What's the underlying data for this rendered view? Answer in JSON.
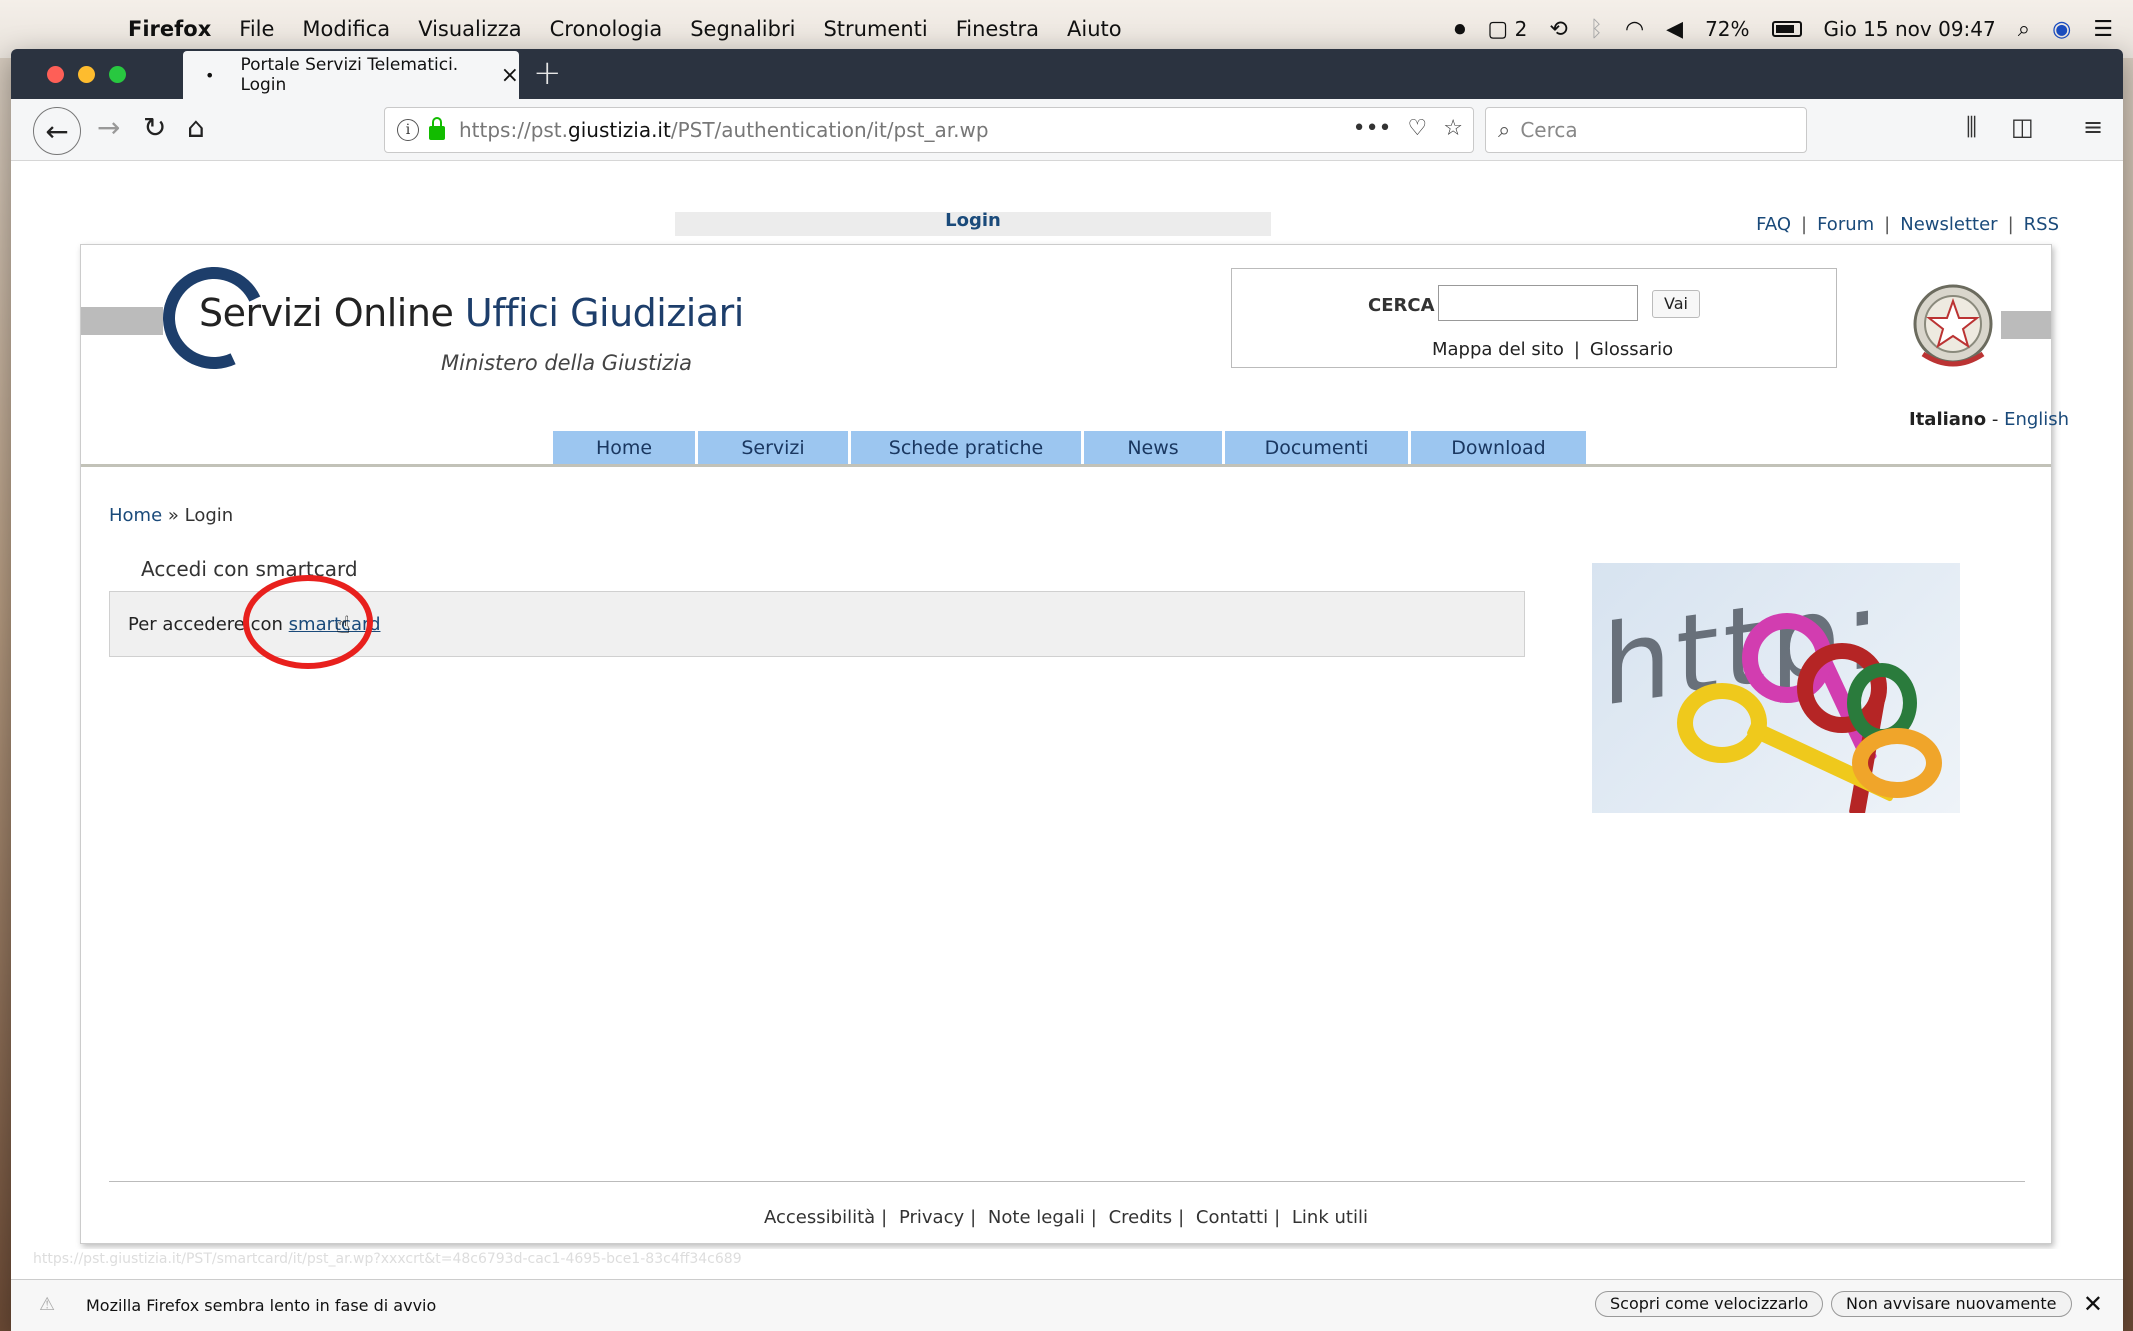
{
  "menubar": {
    "app": "Firefox",
    "items": [
      "File",
      "Modifica",
      "Visualizza",
      "Cronologia",
      "Segnalibri",
      "Strumenti",
      "Finestra",
      "Aiuto"
    ],
    "desktop_count": "2",
    "battery": "72%",
    "datetime": "Gio 15 nov  09:47"
  },
  "browser": {
    "tab_title": "Portale Servizi Telematici. Login",
    "url_prefix": "https://pst.",
    "url_host": "giustizia.it",
    "url_path": "/PST/authentication/it/pst_ar.wp",
    "search_placeholder": "Cerca"
  },
  "page": {
    "top_title": "Login",
    "top_links": [
      "FAQ",
      "Forum",
      "Newsletter",
      "RSS"
    ],
    "logo_part1": "Servizi Online ",
    "logo_part2": "Uffici Giudiziari",
    "logo_sub": "Ministero della Giustizia",
    "search_label": "CERCA",
    "search_button": "Vai",
    "sitemap": "Mappa del sito",
    "glossary": "Glossario",
    "lang_it": "Italiano",
    "lang_en": "English",
    "nav": [
      "Home",
      "Servizi",
      "Schede pratiche",
      "News",
      "Documenti",
      "Download"
    ],
    "breadcrumb_home": "Home",
    "breadcrumb_current": "Login",
    "box_title": "Accedi con smartcard",
    "box_text": "Per accedere con ",
    "box_link": "smartcard",
    "keys_text": "http:",
    "footer": [
      "Accessibilità",
      "Privacy",
      "Note legali",
      "Credits",
      "Contatti",
      "Link utili"
    ]
  },
  "status": {
    "hover_url": "https://pst.giustizia.it/PST/smartcard/it/pst_ar.wp?xxxcrt&t=48c6793d-cac1-4695-bce1-83c4ff34c689",
    "notification": "Mozilla Firefox sembra lento in fase di avvio",
    "btn_learn": "Scopri come velocizzarlo",
    "btn_dismiss": "Non avvisare nuovamente"
  }
}
